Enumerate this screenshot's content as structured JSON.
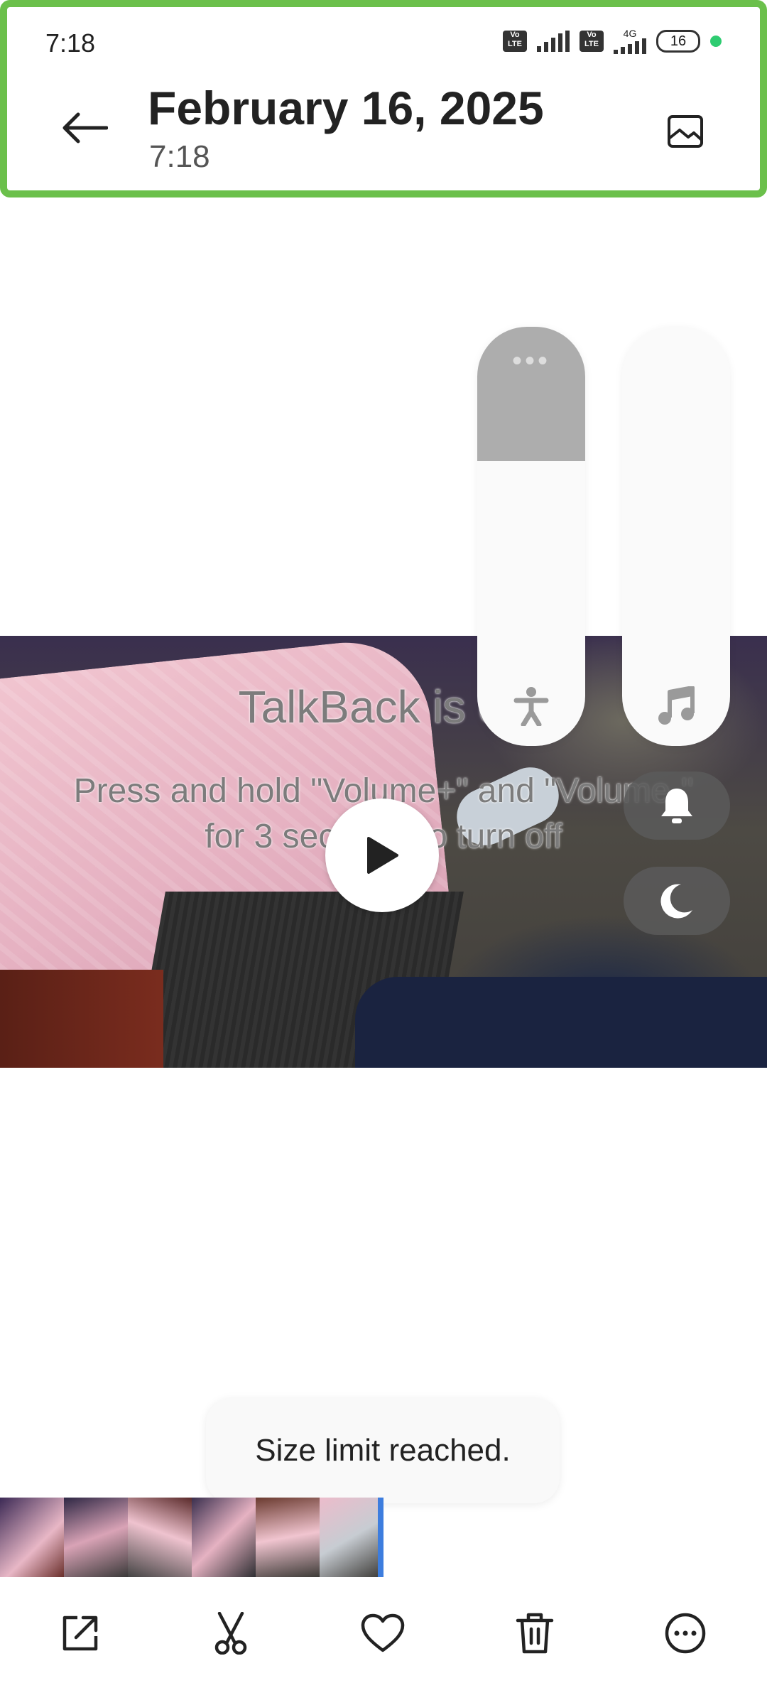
{
  "status_bar": {
    "time": "7:18",
    "sim1_badge": "Vo LTE",
    "sim2_badge": "Vo LTE",
    "network": "4G",
    "battery": "16",
    "icons": [
      "volte-icon",
      "signal-icon",
      "volte-icon",
      "signal-4g-icon",
      "battery-icon",
      "privacy-dot-icon"
    ]
  },
  "header": {
    "title": "February 16, 2025",
    "subtitle": "7:18",
    "back_icon": "arrow-left-icon",
    "gallery_icon": "image-icon"
  },
  "video": {
    "play_icon": "play-icon"
  },
  "talkback": {
    "title": "TalkBack is on",
    "hint_line1": "Press and hold \"Volume+\" and \"Volume-\"",
    "hint_line2": "for 3 seconds to turn off"
  },
  "volume_panel": {
    "accessibility_level": 0.32,
    "media_level": 0.0,
    "more_icon": "more-dots-icon",
    "accessibility_icon": "accessibility-icon",
    "media_icon": "music-note-icon",
    "ring_icon": "bell-icon",
    "dnd_icon": "moon-icon"
  },
  "toast": {
    "message": "Size limit reached."
  },
  "toolbar": {
    "icons": [
      "share-icon",
      "scissors-icon",
      "heart-icon",
      "trash-icon",
      "more-circle-icon"
    ]
  },
  "colors": {
    "focus_outline": "#6bc04b",
    "slider_fill": "#adadad",
    "strip_marker": "#3d7dde",
    "privacy_dot": "#2ecc71"
  }
}
